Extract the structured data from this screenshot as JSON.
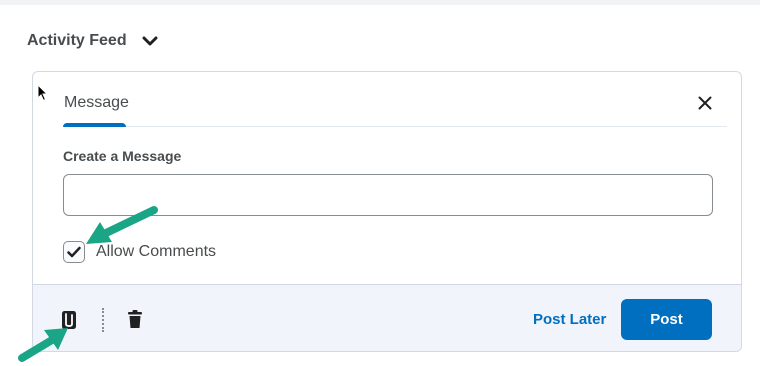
{
  "feed": {
    "title": "Activity Feed",
    "toggle_icon": "chevron-down-icon"
  },
  "editor": {
    "tab_label": "Message",
    "close_icon": "close-icon",
    "field_label": "Create a Message",
    "message_value": "",
    "allow_comments_label": "Allow Comments",
    "allow_comments_checked": true
  },
  "footer": {
    "attach_icon": "paperclip-icon",
    "delete_icon": "trash-icon",
    "post_later_label": "Post Later",
    "post_label": "Post"
  },
  "annotations": {
    "arrow_color": "#1aa586"
  },
  "colors": {
    "accent": "#006fbf",
    "footer_bg": "#f1f5fb",
    "text": "#494c4e"
  }
}
